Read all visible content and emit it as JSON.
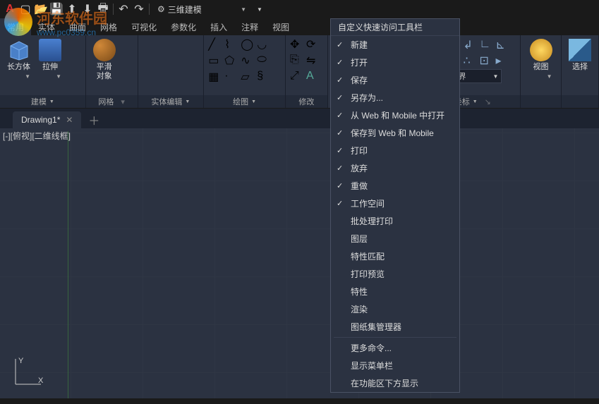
{
  "qat": {
    "workspace_label": "三维建模",
    "gear": "gear",
    "icons": [
      "app",
      "new",
      "open",
      "save",
      "undo",
      "redo",
      "print"
    ]
  },
  "ribbon_tabs": [
    "常用",
    "实体",
    "曲面",
    "网格",
    "可视化",
    "参数化",
    "插入",
    "注释",
    "视图"
  ],
  "active_tab": 0,
  "ribbon": {
    "panel_model": "建模",
    "panel_mesh": "网格",
    "panel_solid": "实体编辑",
    "panel_draw": "绘图",
    "panel_modify": "修改",
    "panel_coord": "坐标",
    "btn_box": "长方体",
    "btn_extrude": "拉伸",
    "btn_smooth": "平滑\n对象",
    "btn_view": "视图",
    "btn_select": "选择",
    "coord_world": "世界"
  },
  "doc": {
    "tab1": "Drawing1*",
    "viewport_label": "[-][俯视][二维线框]"
  },
  "watermark": {
    "line1": "河东软件园",
    "line2": "www.pc0359.cn"
  },
  "menu": {
    "header": "自定义快速访问工具栏",
    "items": [
      {
        "label": "新建",
        "checked": true
      },
      {
        "label": "打开",
        "checked": true
      },
      {
        "label": "保存",
        "checked": true
      },
      {
        "label": "另存为...",
        "checked": true
      },
      {
        "label": "从 Web 和 Mobile 中打开",
        "checked": true
      },
      {
        "label": "保存到 Web 和 Mobile",
        "checked": true
      },
      {
        "label": "打印",
        "checked": true
      },
      {
        "label": "放弃",
        "checked": true
      },
      {
        "label": "重做",
        "checked": true
      },
      {
        "label": "工作空间",
        "checked": true
      },
      {
        "label": "批处理打印",
        "checked": false
      },
      {
        "label": "图层",
        "checked": false
      },
      {
        "label": "特性匹配",
        "checked": false
      },
      {
        "label": "打印预览",
        "checked": false
      },
      {
        "label": "特性",
        "checked": false
      },
      {
        "label": "渲染",
        "checked": false
      },
      {
        "label": "图纸集管理器",
        "checked": false
      }
    ],
    "footer": [
      {
        "label": "更多命令..."
      },
      {
        "label": "显示菜单栏"
      },
      {
        "label": "在功能区下方显示"
      }
    ]
  }
}
